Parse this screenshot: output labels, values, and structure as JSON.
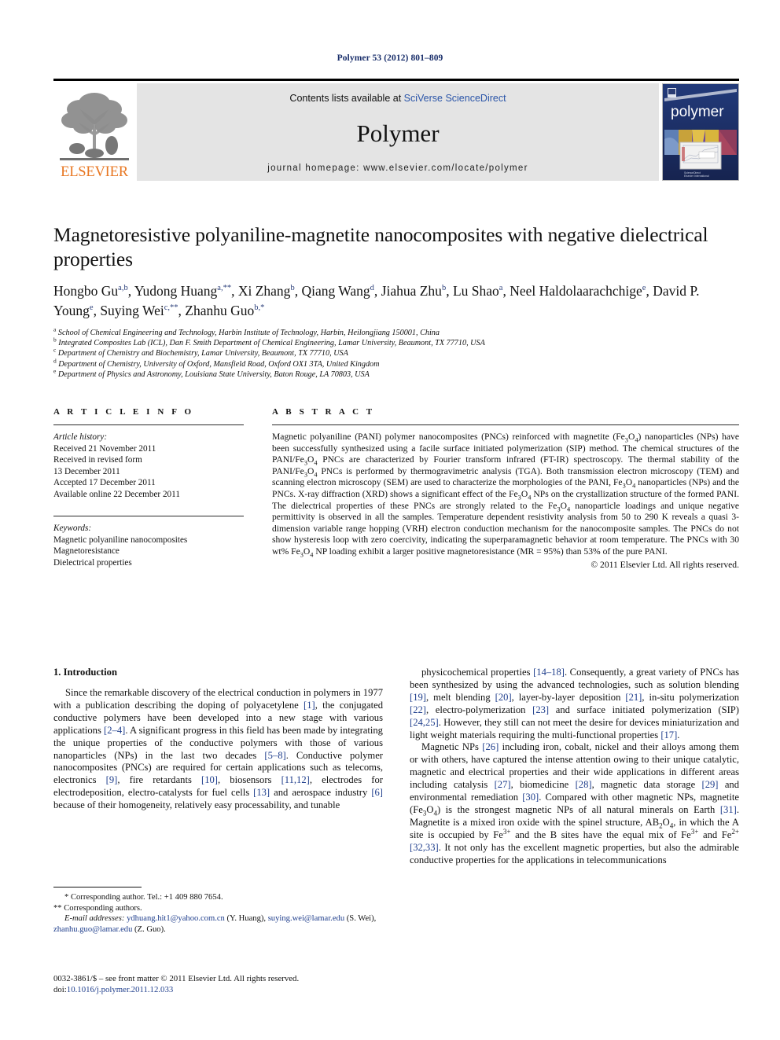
{
  "running_head": "Polymer 53 (2012) 801–809",
  "masthead": {
    "contents_prefix": "Contents lists available at ",
    "contents_link": "SciVerse ScienceDirect",
    "journal_title": "Polymer",
    "homepage": "journal homepage: www.elsevier.com/locate/polymer",
    "publisher_name": "ELSEVIER",
    "cover_word": "polymer"
  },
  "title": "Magnetoresistive polyaniline-magnetite nanocomposites with negative dielectrical properties",
  "authors": [
    {
      "name": "Hongbo Gu",
      "marks": "a,b",
      "sep": ", "
    },
    {
      "name": "Yudong Huang",
      "marks": "a,**",
      "sep": ", "
    },
    {
      "name": "Xi Zhang",
      "marks": "b",
      "sep": ", "
    },
    {
      "name": "Qiang Wang",
      "marks": "d",
      "sep": ", "
    },
    {
      "name": "Jiahua Zhu",
      "marks": "b",
      "sep": ", "
    },
    {
      "name": "Lu Shao",
      "marks": "a",
      "sep": ", "
    },
    {
      "name": "Neel Haldolaarachchige",
      "marks": "e",
      "sep": ", "
    },
    {
      "name": "David P. Young",
      "marks": "e",
      "sep": ", "
    },
    {
      "name": "Suying Wei",
      "marks": "c,**",
      "sep": ", "
    },
    {
      "name": "Zhanhu Guo",
      "marks": "b,*",
      "sep": ""
    }
  ],
  "affiliations": [
    {
      "mark": "a",
      "text": "School of Chemical Engineering and Technology, Harbin Institute of Technology, Harbin, Heilongjiang 150001, China"
    },
    {
      "mark": "b",
      "text": "Integrated Composites Lab (ICL), Dan F. Smith Department of Chemical Engineering, Lamar University, Beaumont, TX 77710, USA"
    },
    {
      "mark": "c",
      "text": "Department of Chemistry and Biochemistry, Lamar University, Beaumont, TX 77710, USA"
    },
    {
      "mark": "d",
      "text": "Department of Chemistry, University of Oxford, Mansfield Road, Oxford OX1 3TA, United Kingdom"
    },
    {
      "mark": "e",
      "text": "Department of Physics and Astronomy, Louisiana State University, Baton Rouge, LA 70803, USA"
    }
  ],
  "article_info": {
    "heading": "A R T I C L E  I N F O",
    "history_label": "Article history:",
    "history": [
      "Received 21 November 2011",
      "Received in revised form",
      "13 December 2011",
      "Accepted 17 December 2011",
      "Available online 22 December 2011"
    ],
    "keywords_label": "Keywords:",
    "keywords": [
      "Magnetic polyaniline nanocomposites",
      "Magnetoresistance",
      "Dielectrical properties"
    ]
  },
  "abstract": {
    "heading": "A B S T R A C T",
    "text_parts": [
      "Magnetic polyaniline (PANI) polymer nanocomposites (PNCs) reinforced with magnetite (Fe",
      "3",
      "O",
      "4",
      ") nanoparticles (NPs) have been successfully synthesized using a facile surface initiated polymerization (SIP) method. The chemical structures of the PANI/Fe3O4 PNCs are characterized by Fourier transform infrared (FT-IR) spectroscopy."
    ],
    "full_text": "Magnetic polyaniline (PANI) polymer nanocomposites (PNCs) reinforced with magnetite (Fe3O4) nanoparticles (NPs) have been successfully synthesized using a facile surface initiated polymerization (SIP) method. The chemical structures of the PANI/Fe3O4 PNCs are characterized by Fourier transform infrared (FT-IR) spectroscopy. The thermal stability of the PANI/Fe3O4 PNCs is performed by thermogravimetric analysis (TGA). Both transmission electron microscopy (TEM) and scanning electron microscopy (SEM) are used to characterize the morphologies of the PANI, Fe3O4 nanoparticles (NPs) and the PNCs. X-ray diffraction (XRD) shows a significant effect of the Fe3O4 NPs on the crystallization structure of the formed PANI. The dielectrical properties of these PNCs are strongly related to the Fe3O4 nanoparticle loadings and unique negative permittivity is observed in all the samples. Temperature dependent resistivity analysis from 50 to 290 K reveals a quasi 3-dimension variable range hopping (VRH) electron conduction mechanism for the nanocomposite samples. The PNCs do not show hysteresis loop with zero coercivity, indicating the superparamagnetic behavior at room temperature. The PNCs with 30 wt% Fe3O4 NP loading exhibit a larger positive magnetoresistance (MR = 95%) than 53% of the pure PANI.",
    "copyright": "© 2011 Elsevier Ltd. All rights reserved."
  },
  "introduction": {
    "heading": "1.  Introduction",
    "left_paragraph_1": "Since the remarkable discovery of the electrical conduction in polymers in 1977 with a publication describing the doping of polyacetylene [1], the conjugated conductive polymers have been developed into a new stage with various applications [2–4]. A significant progress in this field has been made by integrating the unique properties of the conductive polymers with those of various nanoparticles (NPs) in the last two decades [5–8]. Conductive polymer nanocomposites (PNCs) are required for certain applications such as telecoms, electronics [9], fire retardants [10], biosensors [11,12], electrodes for electrodeposition, electro-catalysts for fuel cells [13] and aerospace industry [6] because of their homogeneity, relatively easy processability, and tunable",
    "right_paragraph_1": "physicochemical properties [14–18]. Consequently, a great variety of PNCs has been synthesized by using the advanced technologies, such as solution blending [19], melt blending [20], layer-by-layer deposition [21], in-situ polymerization [22], electro-polymerization [23] and surface initiated polymerization (SIP) [24,25]. However, they still can not meet the desire for devices miniaturization and light weight materials requiring the multi-functional properties [17].",
    "right_paragraph_2": "Magnetic NPs [26] including iron, cobalt, nickel and their alloys among them or with others, have captured the intense attention owing to their unique catalytic, magnetic and electrical properties and their wide applications in different areas including catalysis [27], biomedicine [28], magnetic data storage [29] and environmental remediation [30]. Compared with other magnetic NPs, magnetite (Fe3O4) is the strongest magnetic NPs of all natural minerals on Earth [31]. Magnetite is a mixed iron oxide with the spinel structure, AB2O4, in which the A site is occupied by Fe3+ and the B sites have the equal mix of Fe3+ and Fe2+ [32,33]. It not only has the excellent magnetic properties, but also the admirable conductive properties for the applications in telecommunications"
  },
  "footnotes": {
    "star_line": "*  Corresponding author. Tel.: +1 409 880 7654.",
    "doublestar_line": "**  Corresponding authors.",
    "email_label": "E-mail addresses:",
    "email_1": "ydhuang.hit1@yahoo.com.cn",
    "email_1_who": "(Y. Huang),",
    "email_2": "suying.wei@lamar.edu",
    "email_2_who": "(S. Wei),",
    "email_3": "zhanhu.guo@lamar.edu",
    "email_3_who": "(Z. Guo)."
  },
  "imprint": {
    "line1": "0032-3861/$ – see front matter © 2011 Elsevier Ltd. All rights reserved.",
    "doi_label": "doi:",
    "doi_value": "10.1016/j.polymer.2011.12.033"
  },
  "colors": {
    "running_head": "#1a2f6b",
    "link": "#2b55a8",
    "reference": "#1f3e8c",
    "elsevier_orange": "#E87722",
    "panel_gray": "#e4e4e4",
    "cover_navy": "#1b2d63"
  }
}
